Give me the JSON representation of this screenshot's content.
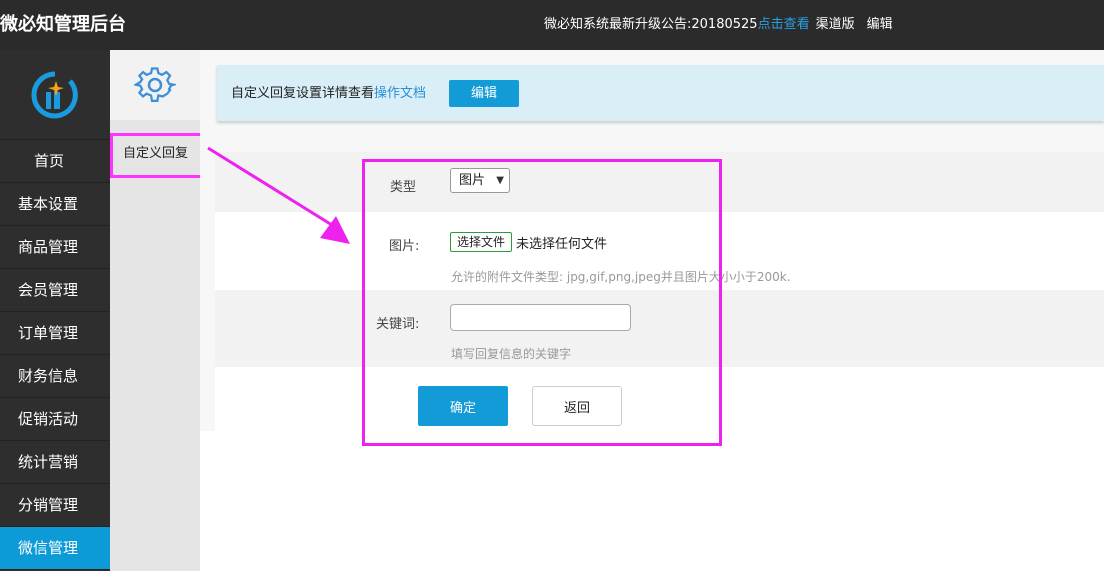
{
  "header": {
    "brand": "微必知管理后台",
    "notice_prefix": "微必知系统最新升级公告:20180525",
    "notice_link": "点击查看",
    "channel": "渠道版",
    "edit": "编辑"
  },
  "sidebar": {
    "items": [
      {
        "label": "首页"
      },
      {
        "label": "基本设置"
      },
      {
        "label": "商品管理"
      },
      {
        "label": "会员管理"
      },
      {
        "label": "订单管理"
      },
      {
        "label": "财务信息"
      },
      {
        "label": "促销活动"
      },
      {
        "label": "统计营销"
      },
      {
        "label": "分销管理"
      },
      {
        "label": "微信管理"
      }
    ],
    "active": "微信管理"
  },
  "subnav": {
    "item": "自定义回复"
  },
  "info": {
    "text": "自定义回复设置详情查看",
    "link": "操作文档",
    "edit_button": "编辑"
  },
  "form": {
    "type_label": "类型",
    "type_value": "图片",
    "image_label": "图片:",
    "file_button": "选择文件",
    "file_status": "未选择任何文件",
    "file_hint": "允许的附件文件类型: jpg,gif,png,jpeg并且图片大小小于200k.",
    "keyword_label": "关键词:",
    "keyword_value": "",
    "keyword_hint": "填写回复信息的关键字",
    "confirm_button": "确定",
    "back_button": "返回"
  },
  "colors": {
    "topbar": "#2b2b2b",
    "sidebar": "#2e2e2e",
    "accent": "#129bd6",
    "highlight": "#ee22ee"
  }
}
